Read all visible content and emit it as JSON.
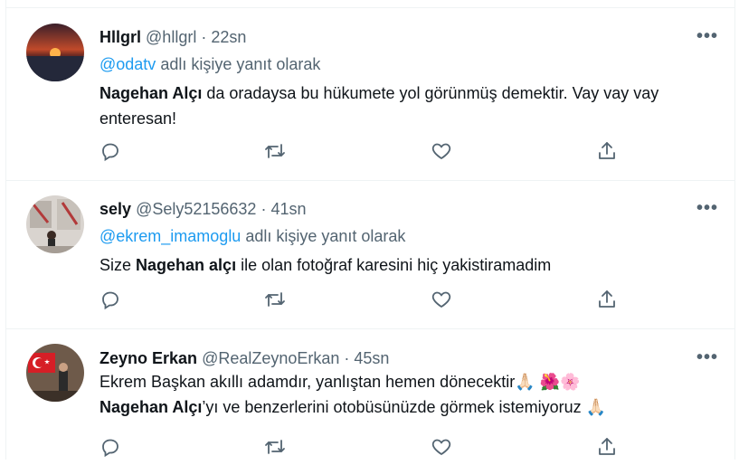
{
  "tweets": [
    {
      "display_name": "Hllgrl",
      "handle": "@hllgrl",
      "sep": " · ",
      "time": "22sn",
      "reply_to": "@odatv",
      "reply_suffix": " adlı kişiye yanıt olarak",
      "body_bold": "Nagehan Alçı",
      "body_rest": " da oradaysa  bu hükumete yol görünmüş demektir. Vay vay vay enteresan!"
    },
    {
      "display_name": "sely",
      "handle": "@Sely52156632",
      "sep": " · ",
      "time": "41sn",
      "reply_to": "@ekrem_imamoglu",
      "reply_suffix": " adlı kişiye yanıt olarak",
      "body_pre": "Size ",
      "body_bold": "Nagehan alçı",
      "body_rest": " ile olan fotoğraf karesini hiç yakistiramadim"
    },
    {
      "display_name": "Zeyno Erkan",
      "handle": "@RealZeynoErkan",
      "sep": " · ",
      "time": "45sn",
      "line1": "Ekrem Başkan akıllı adamdır, yanlıştan hemen dönecektir",
      "line1_emoji": "🙏🏻 🌺🌸",
      "body_bold": "Nagehan Alçı",
      "line2_rest": "’yı ve benzerlerini otobüsünüzde görmek istemiyoruz",
      "line2_emoji": "🙏🏻"
    }
  ],
  "more_label": "•••",
  "colors": {
    "accent": "#1d9bf0",
    "secondary_text": "#536471",
    "border": "#eff3f4"
  },
  "icons": [
    "reply-icon",
    "retweet-icon",
    "like-icon",
    "share-icon",
    "more-icon"
  ]
}
